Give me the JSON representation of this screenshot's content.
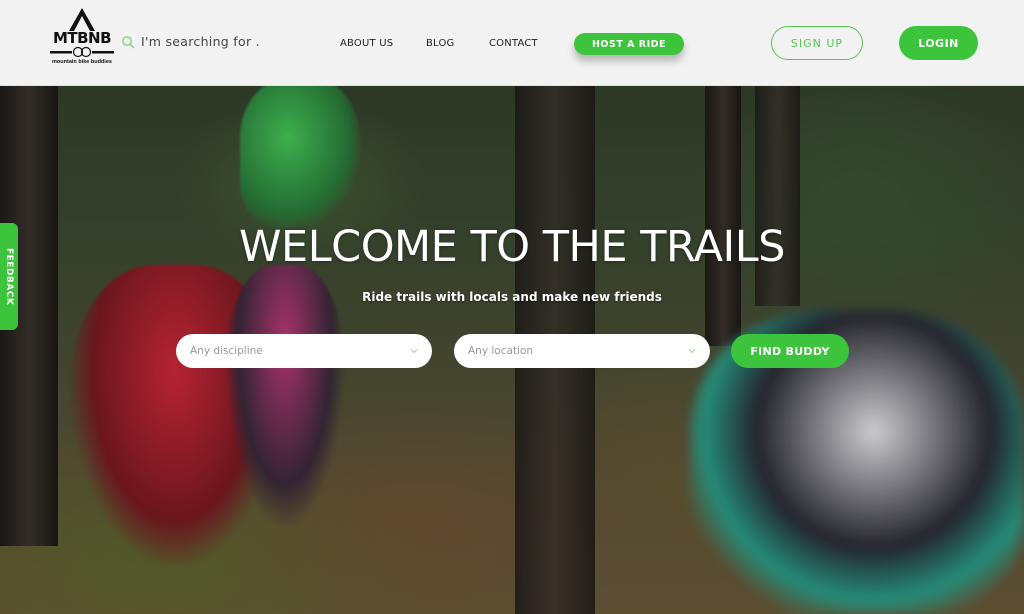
{
  "header": {
    "logo": {
      "name": "MTBNB",
      "tagline": "mountain bike buddies"
    },
    "search": {
      "placeholder": "I'm searching for .",
      "icon": "search-icon"
    },
    "nav": [
      {
        "label": "ABOUT US"
      },
      {
        "label": "BLOG"
      },
      {
        "label": "CONTACT"
      }
    ],
    "host_button": "HOST A RIDE",
    "signup_button": "SIGN UP",
    "login_button": "LOGIN"
  },
  "feedback_tab": "FEEDBACK",
  "hero": {
    "title": "WELCOME TO THE TRAILS",
    "subtitle": "Ride trails with locals and make new friends",
    "discipline_select": {
      "value": "Any discipline"
    },
    "location_select": {
      "value": "Any location"
    },
    "find_button": "FIND BUDDY"
  },
  "colors": {
    "accent": "#3cc53c",
    "header_bg": "#f2f2f2",
    "text_dark": "#222222"
  }
}
